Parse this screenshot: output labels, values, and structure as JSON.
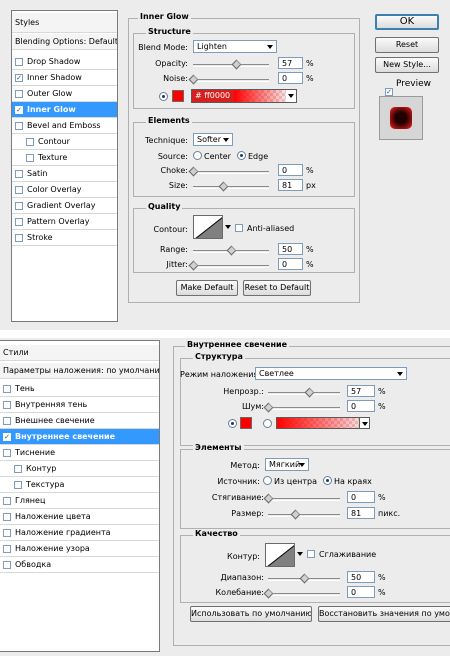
{
  "en": {
    "panel": {
      "styles": "Styles",
      "blending": "Blending Options: Default",
      "items": [
        {
          "label": "Drop Shadow",
          "checked": false
        },
        {
          "label": "Inner Shadow",
          "checked": true
        },
        {
          "label": "Outer Glow",
          "checked": false
        },
        {
          "label": "Inner Glow",
          "checked": true
        },
        {
          "label": "Bevel and Emboss",
          "checked": false
        },
        {
          "label": "Contour",
          "checked": false
        },
        {
          "label": "Texture",
          "checked": false
        },
        {
          "label": "Satin",
          "checked": false
        },
        {
          "label": "Color Overlay",
          "checked": false
        },
        {
          "label": "Gradient Overlay",
          "checked": false
        },
        {
          "label": "Pattern Overlay",
          "checked": false
        },
        {
          "label": "Stroke",
          "checked": false
        }
      ]
    },
    "title": "Inner Glow",
    "structure": {
      "title": "Structure",
      "blend_mode_label": "Blend Mode:",
      "blend_mode": "Lighten",
      "opacity_label": "Opacity:",
      "opacity": "57",
      "noise_label": "Noise:",
      "noise": "0",
      "pct": "%",
      "hex": "# ff0000"
    },
    "elements": {
      "title": "Elements",
      "technique_label": "Technique:",
      "technique": "Softer",
      "source_label": "Source:",
      "center": "Center",
      "edge": "Edge",
      "choke_label": "Choke:",
      "choke": "0",
      "size_label": "Size:",
      "size": "81",
      "px": "px"
    },
    "quality": {
      "title": "Quality",
      "contour_label": "Contour:",
      "anti_aliased": "Anti-aliased",
      "range_label": "Range:",
      "range": "50",
      "jitter_label": "Jitter:",
      "jitter": "0"
    },
    "make_default": "Make Default",
    "reset_default": "Reset to Default",
    "ok": "OK",
    "reset": "Reset",
    "new_style": "New Style...",
    "preview": "Preview"
  },
  "ru": {
    "panel": {
      "styles": "Стили",
      "blending": "Параметры наложения: по умолчанию",
      "items": [
        {
          "label": "Тень",
          "checked": false
        },
        {
          "label": "Внутренняя тень",
          "checked": false
        },
        {
          "label": "Внешнее свечение",
          "checked": false
        },
        {
          "label": "Внутреннее свечение",
          "checked": true
        },
        {
          "label": "Тиснение",
          "checked": false
        },
        {
          "label": "Контур",
          "checked": false
        },
        {
          "label": "Текстура",
          "checked": false
        },
        {
          "label": "Глянец",
          "checked": false
        },
        {
          "label": "Наложение цвета",
          "checked": false
        },
        {
          "label": "Наложение градиента",
          "checked": false
        },
        {
          "label": "Наложение узора",
          "checked": false
        },
        {
          "label": "Обводка",
          "checked": false
        }
      ]
    },
    "title": "Внутреннее свечение",
    "structure": {
      "title": "Структура",
      "blend_mode_label": "Режим наложения:",
      "blend_mode": "Светлее",
      "opacity_label": "Непрозр.:",
      "opacity": "57",
      "noise_label": "Шум:",
      "noise": "0",
      "pct": "%"
    },
    "elements": {
      "title": "Элементы",
      "technique_label": "Метод:",
      "technique": "Мягкий",
      "source_label": "Источник:",
      "center": "Из центра",
      "edge": "На краях",
      "choke_label": "Стягивание:",
      "choke": "0",
      "size_label": "Размер:",
      "size": "81",
      "px": "пикс."
    },
    "quality": {
      "title": "Качество",
      "contour_label": "Контур:",
      "anti_aliased": "Сглаживание",
      "range_label": "Диапазон:",
      "range": "50",
      "jitter_label": "Колебание:",
      "jitter": "0"
    },
    "make_default": "Использовать по умолчанию",
    "reset_default": "Восстановить значения по умолчанию"
  },
  "colors": {
    "glow": "#ff0000",
    "selection": "#3399ff",
    "dialog_bg": "#ececec"
  },
  "icons": [
    "checkbox-icon",
    "radio-icon",
    "slider-thumb-icon",
    "dropdown-arrow-icon",
    "contour-curve-icon"
  ]
}
